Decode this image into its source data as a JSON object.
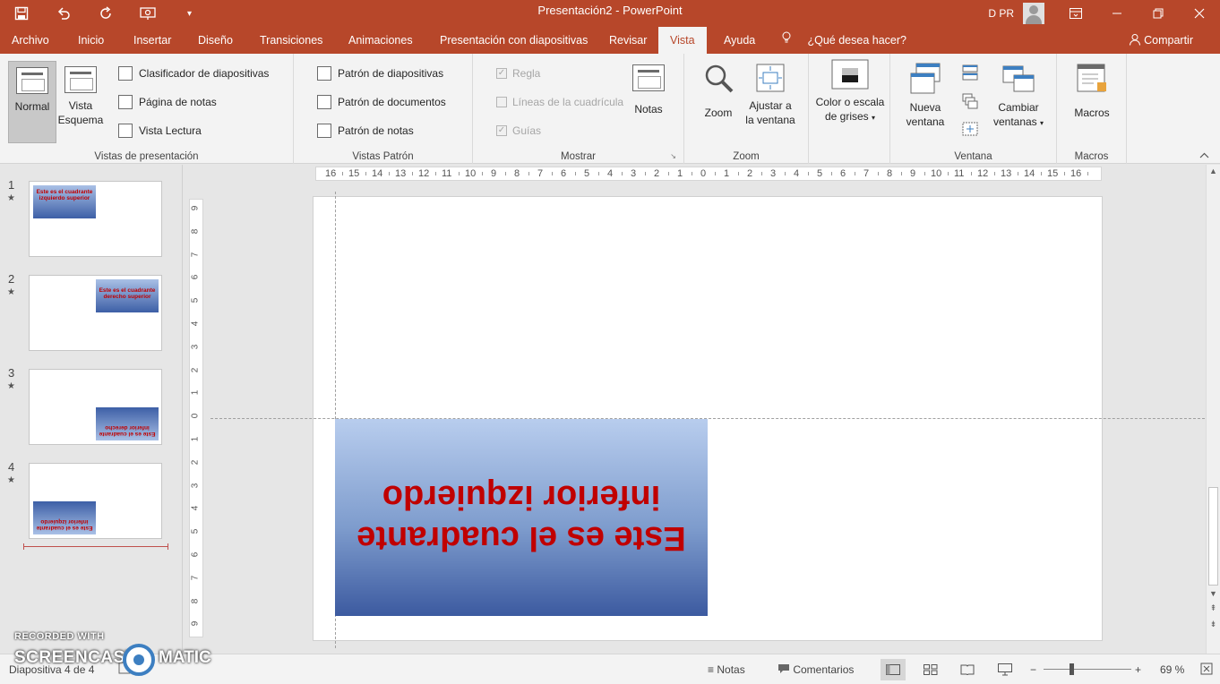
{
  "titlebar": {
    "title": "Presentación2  -  PowerPoint",
    "user": "D PR",
    "qat": [
      "save-icon",
      "undo-icon",
      "redo-icon",
      "present-icon",
      "customize-icon"
    ],
    "win": [
      "ribbon-display-icon",
      "minimize-icon",
      "restore-icon",
      "close-icon"
    ]
  },
  "tabs": [
    "Archivo",
    "Inicio",
    "Insertar",
    "Diseño",
    "Transiciones",
    "Animaciones",
    "Presentación con diapositivas",
    "Revisar",
    "Vista",
    "Ayuda"
  ],
  "active_tab": "Vista",
  "tell_me": "¿Qué desea hacer?",
  "share": "Compartir",
  "ribbon": {
    "vistas_presentacion": {
      "label": "Vistas de presentación",
      "normal": "Normal",
      "esquema_1": "Vista",
      "esquema_2": "Esquema",
      "clasificador": "Clasificador de diapositivas",
      "pagina_notas": "Página de notas",
      "lectura": "Vista Lectura"
    },
    "vistas_patron": {
      "label": "Vistas Patrón",
      "diapositivas": "Patrón de diapositivas",
      "documentos": "Patrón de documentos",
      "notas": "Patrón de notas"
    },
    "mostrar": {
      "label": "Mostrar",
      "regla": "Regla",
      "cuadricula": "Líneas de la cuadrícula",
      "guias": "Guías",
      "notas": "Notas"
    },
    "zoom": {
      "label": "Zoom",
      "zoom": "Zoom",
      "ajustar_1": "Ajustar a",
      "ajustar_2": "la ventana"
    },
    "color": {
      "line1": "Color o escala",
      "line2": "de grises"
    },
    "ventana": {
      "label": "Ventana",
      "nueva_1": "Nueva",
      "nueva_2": "ventana",
      "cambiar_1": "Cambiar",
      "cambiar_2": "ventanas"
    },
    "macros": {
      "label": "Macros",
      "macros": "Macros"
    }
  },
  "thumbnails": [
    {
      "num": "1",
      "text": "Este es el cuadrante izquierdo superior"
    },
    {
      "num": "2",
      "text": "Este es el cuadrante derecho superior"
    },
    {
      "num": "3",
      "text": "Este es el cuadrante inferior derecho"
    },
    {
      "num": "4",
      "text": "Este es el cuadrante inferior izquierdo"
    }
  ],
  "slide": {
    "textbox": "Este es el cuadrante inferior izquierdo"
  },
  "ruler": {
    "h": [
      "16",
      "15",
      "14",
      "13",
      "12",
      "11",
      "10",
      "9",
      "8",
      "7",
      "6",
      "5",
      "4",
      "3",
      "2",
      "1",
      "0",
      "1",
      "2",
      "3",
      "4",
      "5",
      "6",
      "7",
      "8",
      "9",
      "10",
      "11",
      "12",
      "13",
      "14",
      "15",
      "16"
    ],
    "v": [
      "9",
      "8",
      "7",
      "6",
      "5",
      "4",
      "3",
      "2",
      "1",
      "0",
      "1",
      "2",
      "3",
      "4",
      "5",
      "6",
      "7",
      "8",
      "9"
    ]
  },
  "status": {
    "slide_info": "Diapositiva 4 de 4",
    "notas": "Notas",
    "comentarios": "Comentarios",
    "zoom_minus": "−",
    "zoom_plus": "+",
    "zoom_level": "69 %"
  },
  "watermark": {
    "recorded": "RECORDED WITH",
    "brand": "SCREENCAST",
    "matic": "MATIC"
  }
}
